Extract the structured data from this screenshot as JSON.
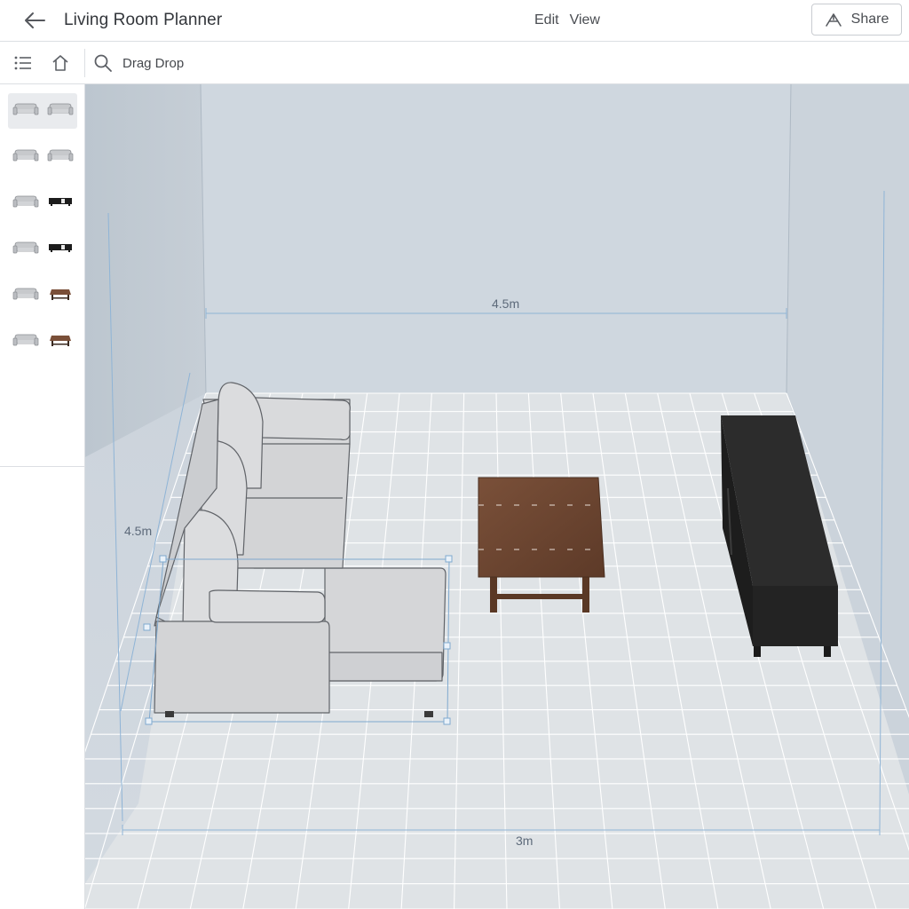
{
  "header": {
    "title": "Living Room Planner",
    "menu": [
      "Edit",
      "View"
    ],
    "share_label": "Share"
  },
  "toolbar": {
    "search_label": "Drag Drop"
  },
  "sidebar": {
    "thumbnails": [
      {
        "left": "sofa",
        "right": "sofa",
        "active": true
      },
      {
        "left": "sofa",
        "right": "sofa",
        "active": false
      },
      {
        "left": "sofa",
        "right": "tv-stand",
        "active": false
      },
      {
        "left": "sofa",
        "right": "tv-stand",
        "active": false
      },
      {
        "left": "sofa",
        "right": "coffee-table",
        "active": false
      },
      {
        "left": "sofa",
        "right": "coffee-table",
        "active": false
      }
    ]
  },
  "canvas": {
    "dimensions": {
      "back_wall": "4.5m",
      "side_wall": "4.5m",
      "front_edge": "3m"
    },
    "colors": {
      "wall": "#cdd5dd",
      "floor": "#dfe3e6",
      "grid": "#ffffff",
      "dimension_line": "#8fb4d6",
      "sofa": "#d9dadc",
      "table": "#6e4633",
      "tv_stand": "#242424"
    }
  }
}
